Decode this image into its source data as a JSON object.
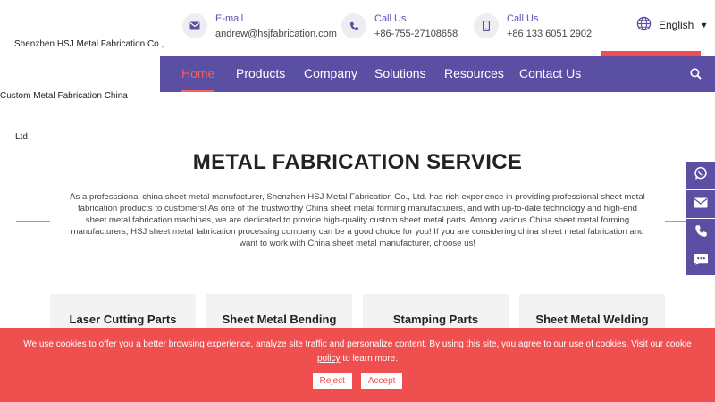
{
  "company": {
    "line1": "Shenzhen HSJ Metal Fabrication Co.,",
    "line2": "Custom Metal Fabrication China",
    "line3": "Ltd."
  },
  "contacts": {
    "email": {
      "label": "E-mail",
      "value": "andrew@hsjfabrication.com",
      "icon": "mail-icon"
    },
    "phone": {
      "label": "Call Us",
      "value": "+86-755-27108658",
      "icon": "phone-icon"
    },
    "mobile": {
      "label": "Call Us",
      "value": "+86 133 6051 2902",
      "icon": "mobile-icon"
    }
  },
  "language": {
    "label": "English"
  },
  "nav": {
    "items": [
      {
        "label": "Home",
        "active": true
      },
      {
        "label": "Products"
      },
      {
        "label": "Company"
      },
      {
        "label": "Solutions"
      },
      {
        "label": "Resources"
      },
      {
        "label": "Contact Us"
      }
    ]
  },
  "main": {
    "title": "METAL FABRICATION SERVICE",
    "intro": "As a professsional china sheet metal manufacturer, Shenzhen HSJ Metal Fabrication Co., Ltd. has rich experience in providing professional sheet metal fabrication products to customers! As one of the trustworthy China sheet metal forming manufacturers, and with up-to-date technology and high-end sheet metal fabrication machines, we are dedicated to provide high-quality custom sheet metal parts. Among various China sheet metal forming manufacturers, HSJ sheet metal fabrication processing company can be a good choice for you! If you are considering china sheet metal fabrication and want to work with China sheet metal manufacturer, choose us!",
    "cards": [
      {
        "label": "Laser Cutting Parts"
      },
      {
        "label": "Sheet Metal Bending"
      },
      {
        "label": "Stamping Parts"
      },
      {
        "label": "Sheet Metal Welding"
      }
    ]
  },
  "side_icons": [
    "whatsapp-icon",
    "email-icon",
    "phone-icon",
    "chat-icon"
  ],
  "cookie": {
    "message": "We use cookies to offer you a better browsing experience, analyze site traffic and personalize content. By using this site, you agree to our use of cookies. Visit our",
    "link": "cookie policy",
    "suffix": " to learn more.",
    "reject": "Reject",
    "accept": "Accept"
  },
  "colors": {
    "accent": "#5b4fa3",
    "brand_red": "#f04f4f",
    "card_bg": "#f3f3f3"
  }
}
